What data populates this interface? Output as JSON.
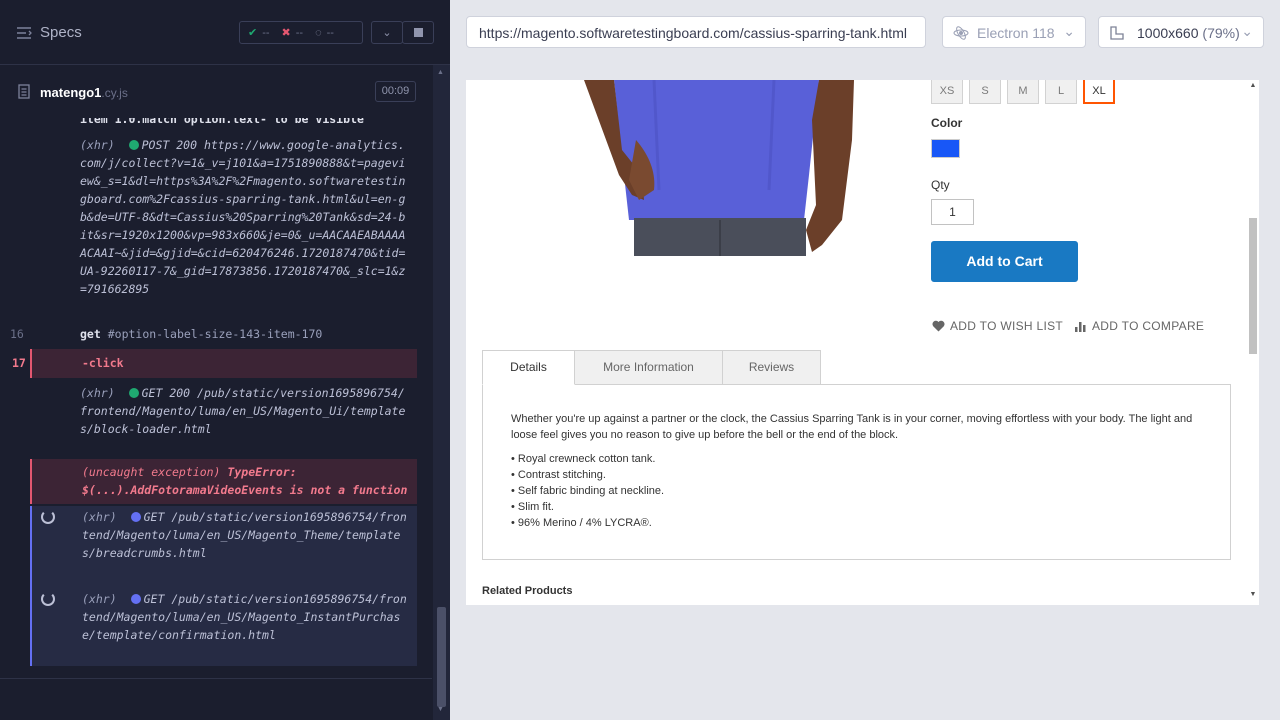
{
  "runner": {
    "specs_label": "Specs",
    "stats": {
      "passed": "--",
      "failed": "--",
      "pending": "--"
    },
    "file": {
      "name": "matengo1",
      "ext": ".cy.js",
      "timer": "00:09"
    },
    "log_top_cut": "item 1.0.match option.text- to be visible",
    "log": [
      {
        "kind": "xhr",
        "prefix": "(xhr)",
        "method": "POST 200",
        "status": "green",
        "url": "https://www.google-analytics.com/j/collect?v=1&_v=j101&a=1751890888&t=pageview&_s=1&dl=https%3A%2F%2Fmagento.softwaretestingboard.com%2Fcassius-sparring-tank.html&ul=en-gb&de=UTF-8&dt=Cassius%20Sparring%20Tank&sd=24-bit&sr=1920x1200&vp=983x660&je=0&_u=AACAAEABAAAAACAAI~&jid=&gjid=&cid=620476246.1720187470&tid=UA-92260117-7&_gid=17873856.1720187470&_slc=1&z=791662895"
      },
      {
        "kind": "cmd",
        "num": "16",
        "name": "get",
        "arg": "#option-label-size-143-item-170"
      },
      {
        "kind": "cmd-active",
        "num": "17",
        "name": "-click"
      },
      {
        "kind": "xhr",
        "prefix": "(xhr)",
        "method": "GET 200",
        "status": "green",
        "url": "/pub/static/version1695896754/frontend/Magento/luma/en_US/Magento_Ui/templates/block-loader.html"
      },
      {
        "kind": "error",
        "prefix": "(uncaught exception)",
        "type": "TypeError:",
        "message": "$(...).AddFotoramaVideoEvents is not a function"
      },
      {
        "kind": "pending",
        "prefix": "(xhr)",
        "method": "GET",
        "status": "blue",
        "url": "/pub/static/version1695896754/frontend/Magento/luma/en_US/Magento_Theme/templates/breadcrumbs.html"
      },
      {
        "kind": "pending",
        "prefix": "(xhr)",
        "method": "GET",
        "status": "blue",
        "url": "/pub/static/version1695896754/frontend/Magento/luma/en_US/Magento_InstantPurchase/template/confirmation.html"
      }
    ]
  },
  "header": {
    "url": "https://magento.softwaretestingboard.com/cassius-sparring-tank.html",
    "browser": "Electron 118",
    "viewport_size": "1000x660",
    "viewport_zoom": "(79%)"
  },
  "product": {
    "sizes": [
      "XS",
      "S",
      "M",
      "L",
      "XL"
    ],
    "selected_size": "XL",
    "color_label": "Color",
    "color_swatch": "#1857f7",
    "qty_label": "Qty",
    "qty_value": "1",
    "add_to_cart": "Add to Cart",
    "wishlist": "ADD TO WISH LIST",
    "compare": "ADD TO COMPARE",
    "tabs": [
      "Details",
      "More Information",
      "Reviews"
    ],
    "description": "Whether you're up against a partner or the clock, the Cassius Sparring Tank is in your corner, moving effortless with your body. The light and loose feel gives you no reason to give up before the bell or the end of the block.",
    "features": [
      "• Royal crewneck cotton tank.",
      "• Contrast stitching.",
      "• Self fabric binding at neckline.",
      "• Slim fit.",
      "• 96% Merino / 4% LYCRA®."
    ],
    "related_title": "Related Products"
  }
}
